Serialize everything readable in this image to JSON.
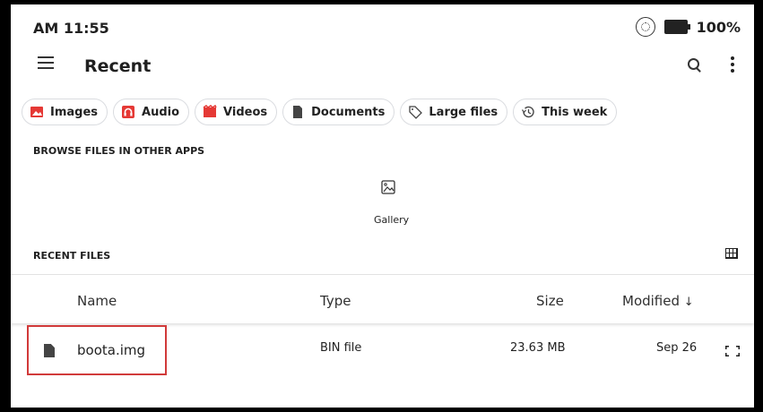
{
  "status_bar": {
    "time": "AM 11:55",
    "battery_text": "100%",
    "icons": [
      "sync-icon",
      "battery-icon"
    ]
  },
  "app_bar": {
    "title": "Recent",
    "icons": [
      "menu-icon",
      "search-icon",
      "more-vert-icon"
    ]
  },
  "chips": [
    {
      "label": "Images",
      "icon": "image-icon",
      "color": "#e53935"
    },
    {
      "label": "Audio",
      "icon": "headphones-icon",
      "color": "#e53935"
    },
    {
      "label": "Videos",
      "icon": "video-icon",
      "color": "#e53935"
    },
    {
      "label": "Documents",
      "icon": "document-icon",
      "color": "#444444"
    },
    {
      "label": "Large files",
      "icon": "tag-icon",
      "color": "#444444"
    },
    {
      "label": "This week",
      "icon": "history-icon",
      "color": "#444444"
    }
  ],
  "browse_section": {
    "label": "BROWSE FILES IN OTHER APPS",
    "apps": [
      {
        "label": "Gallery",
        "icon": "gallery-icon"
      }
    ]
  },
  "recent_section": {
    "label": "RECENT FILES",
    "view_toggle_icon": "grid-view-icon"
  },
  "table": {
    "headers": {
      "name": "Name",
      "type": "Type",
      "size": "Size",
      "modified": "Modified"
    },
    "sort_icon": "arrow-down-icon",
    "rows": [
      {
        "name": "boota.img",
        "type": "BIN file",
        "size": "23.63 MB",
        "modified": "Sep 26",
        "icon": "file-icon",
        "action_icon": "expand-icon"
      }
    ]
  },
  "colors": {
    "chip_red": "#e53935",
    "highlight": "#d13a3a"
  }
}
